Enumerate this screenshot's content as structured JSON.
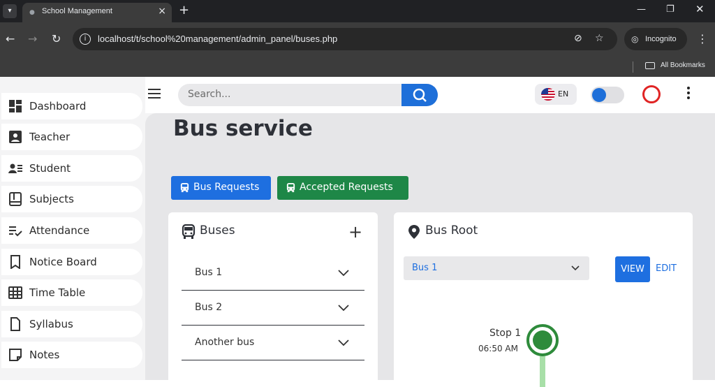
{
  "browser": {
    "tab_title": "School Management",
    "url": "localhost/t/school%20management/admin_panel/buses.php",
    "incognito_label": "Incognito",
    "bookmarks_label": "All Bookmarks"
  },
  "sidebar": {
    "items": [
      {
        "label": "Dashboard",
        "icon": "dashboard-icon"
      },
      {
        "label": "Teacher",
        "icon": "teacher-icon"
      },
      {
        "label": "Student",
        "icon": "student-icon"
      },
      {
        "label": "Subjects",
        "icon": "book-icon"
      },
      {
        "label": "Attendance",
        "icon": "checklist-icon"
      },
      {
        "label": "Notice Board",
        "icon": "bookmark-icon"
      },
      {
        "label": "Time Table",
        "icon": "grid-icon"
      },
      {
        "label": "Syllabus",
        "icon": "file-icon"
      },
      {
        "label": "Notes",
        "icon": "note-icon"
      }
    ]
  },
  "topbar": {
    "search_placeholder": "Search...",
    "language": "EN"
  },
  "main": {
    "title": "Bus service",
    "buttons": {
      "bus_requests": "Bus Requests",
      "accepted_requests": "Accepted Requests"
    },
    "buses_card": {
      "title": "Buses",
      "items": [
        "Bus 1",
        "Bus 2",
        "Another bus"
      ]
    },
    "root_card": {
      "title": "Bus Root",
      "selected_bus": "Bus 1",
      "view_label": "VIEW",
      "edit_label": "EDIT",
      "stops": [
        {
          "name": "Stop 1",
          "time": "06:50 AM"
        }
      ]
    }
  },
  "colors": {
    "primary": "#1e6fe0",
    "success": "#1e8747",
    "danger": "#e02424",
    "route": "#2e8b3b"
  }
}
